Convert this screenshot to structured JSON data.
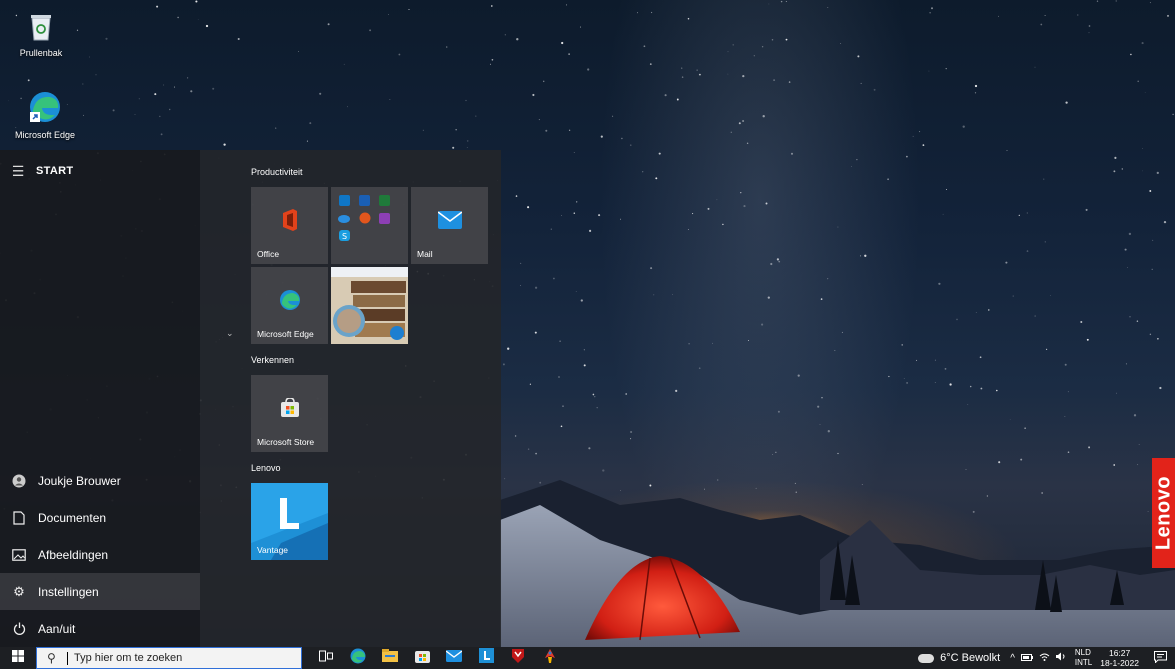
{
  "desktop": {
    "icons": [
      {
        "label": "Prullenbak",
        "icon": "recycle-bin-icon"
      },
      {
        "label": "Microsoft Edge",
        "icon": "edge-icon"
      }
    ],
    "brand_badge": "Lenovo"
  },
  "start_menu": {
    "header": {
      "title": "START",
      "menu_icon": "hamburger-icon"
    },
    "left_items": [
      {
        "label": "Joukje Brouwer",
        "icon": "user-avatar-icon"
      },
      {
        "label": "Documenten",
        "icon": "document-icon"
      },
      {
        "label": "Afbeeldingen",
        "icon": "pictures-icon"
      },
      {
        "label": "Instellingen",
        "icon": "gear-icon"
      },
      {
        "label": "Aan/uit",
        "icon": "power-icon"
      }
    ],
    "groups": [
      {
        "name": "Productiviteit",
        "tiles": [
          {
            "label": "Office",
            "icon": "office-icon"
          },
          {
            "label": "",
            "icon": "office-apps-folder-icon"
          },
          {
            "label": "Mail",
            "icon": "mail-icon"
          },
          {
            "label": "Microsoft Edge",
            "icon": "edge-icon"
          },
          {
            "label": "",
            "icon": "photo-live-tile"
          }
        ]
      },
      {
        "name": "Verkennen",
        "tiles": [
          {
            "label": "Microsoft Store",
            "icon": "store-icon"
          }
        ]
      },
      {
        "name": "Lenovo",
        "tiles": [
          {
            "label": "Vantage",
            "icon": "lenovo-vantage-icon"
          }
        ]
      }
    ]
  },
  "taskbar": {
    "search_placeholder": "Typ hier om te zoeken",
    "apps": [
      "task-view-icon",
      "edge-icon",
      "file-explorer-icon",
      "store-icon",
      "mail-icon",
      "lenovo-vantage-icon",
      "mcafee-icon",
      "paint-icon"
    ],
    "weather": "6°C Bewolkt",
    "language": "NLD",
    "keyboard": "INTL",
    "time": "16:27",
    "date": "18-1-2022"
  },
  "colors": {
    "taskbar_bg": "#1d1f23",
    "accent": "#0078d4",
    "vantage_tile": "#1e90d6",
    "lenovo_red": "#e2231a"
  }
}
